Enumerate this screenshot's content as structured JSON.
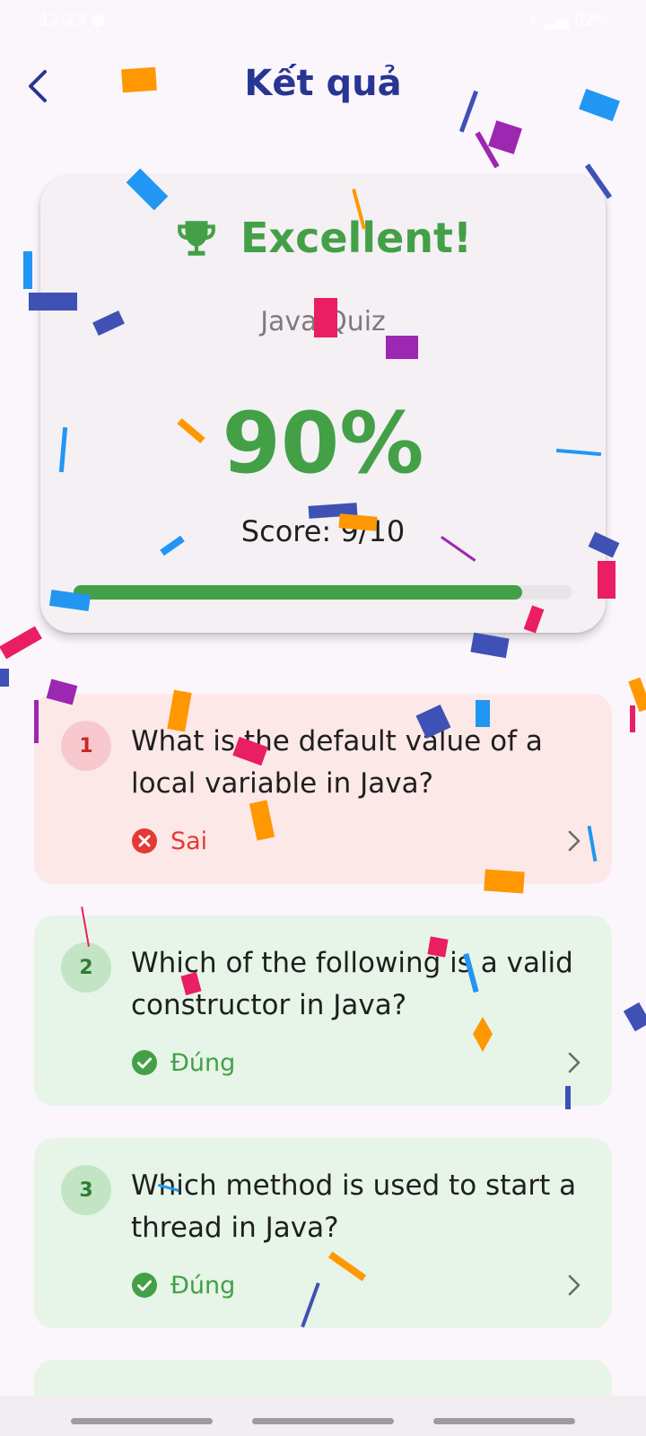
{
  "status_bar": {
    "time": "12:23 ●",
    "indicators": "⚡ ▂▄ 82%"
  },
  "header": {
    "title": "Kết quả",
    "back_icon": "chevron-left-icon"
  },
  "result": {
    "label": "Excellent!",
    "icon": "trophy-icon",
    "quiz_name": "Java Quiz",
    "percent_text": "90%",
    "score_text": "Score: 9/10",
    "progress": 0.9
  },
  "questions": [
    {
      "number": "1",
      "text": "What is the default value of a local variable in Java?",
      "status_label": "Sai",
      "correct": false
    },
    {
      "number": "2",
      "text": "Which of the following is a valid constructor in Java?",
      "status_label": "Đúng",
      "correct": true
    },
    {
      "number": "3",
      "text": "Which method is used to start a thread in Java?",
      "status_label": "Đúng",
      "correct": true
    }
  ],
  "colors": {
    "title": "#283593",
    "success": "#43a047",
    "error": "#e53935",
    "wrong_card": "#fde8e8",
    "right_card": "#e6f5e7",
    "confetti": [
      "#2196f3",
      "#3f51b5",
      "#9c27b0",
      "#e91e63",
      "#ff9800"
    ]
  }
}
